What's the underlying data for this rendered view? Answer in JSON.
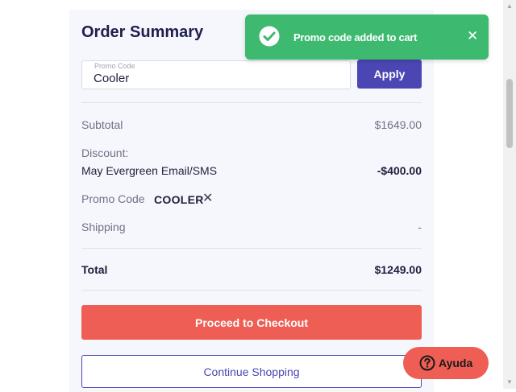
{
  "order_summary": {
    "title": "Order Summary",
    "promo_input": {
      "label": "Promo Code",
      "value": "Cooler"
    },
    "apply_label": "Apply",
    "subtotal": {
      "label": "Subtotal",
      "value": "$1649.00"
    },
    "discount": {
      "label": "Discount:",
      "name": "May Evergreen Email/SMS",
      "value": "-$400.00"
    },
    "promo_code": {
      "label": "Promo Code",
      "code": "COOLER",
      "remove_glyph": "✕"
    },
    "shipping": {
      "label": "Shipping",
      "value": "-"
    },
    "total": {
      "label": "Total",
      "value": "$1249.00"
    },
    "checkout_label": "Proceed to Checkout",
    "continue_label": "Continue Shopping"
  },
  "toast": {
    "message": "Promo code added to cart",
    "icon": "check-circle-icon",
    "close_glyph": "✕"
  },
  "help": {
    "label": "Ayuda",
    "icon": "question-circle-icon"
  },
  "colors": {
    "primary": "#4b46b3",
    "checkout": "#ee5e54",
    "toast": "#3eb970",
    "heading": "#1f1f4d"
  }
}
